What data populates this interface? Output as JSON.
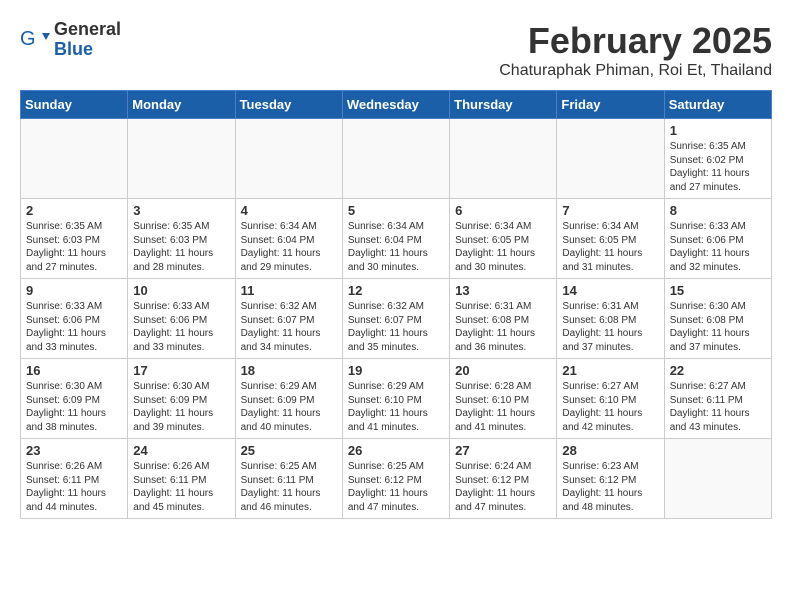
{
  "logo": {
    "general": "General",
    "blue": "Blue"
  },
  "title": "February 2025",
  "subtitle": "Chaturaphak Phiman, Roi Et, Thailand",
  "days_of_week": [
    "Sunday",
    "Monday",
    "Tuesday",
    "Wednesday",
    "Thursday",
    "Friday",
    "Saturday"
  ],
  "weeks": [
    [
      {
        "day": "",
        "info": ""
      },
      {
        "day": "",
        "info": ""
      },
      {
        "day": "",
        "info": ""
      },
      {
        "day": "",
        "info": ""
      },
      {
        "day": "",
        "info": ""
      },
      {
        "day": "",
        "info": ""
      },
      {
        "day": "1",
        "info": "Sunrise: 6:35 AM\nSunset: 6:02 PM\nDaylight: 11 hours and 27 minutes."
      }
    ],
    [
      {
        "day": "2",
        "info": "Sunrise: 6:35 AM\nSunset: 6:03 PM\nDaylight: 11 hours and 27 minutes."
      },
      {
        "day": "3",
        "info": "Sunrise: 6:35 AM\nSunset: 6:03 PM\nDaylight: 11 hours and 28 minutes."
      },
      {
        "day": "4",
        "info": "Sunrise: 6:34 AM\nSunset: 6:04 PM\nDaylight: 11 hours and 29 minutes."
      },
      {
        "day": "5",
        "info": "Sunrise: 6:34 AM\nSunset: 6:04 PM\nDaylight: 11 hours and 30 minutes."
      },
      {
        "day": "6",
        "info": "Sunrise: 6:34 AM\nSunset: 6:05 PM\nDaylight: 11 hours and 30 minutes."
      },
      {
        "day": "7",
        "info": "Sunrise: 6:34 AM\nSunset: 6:05 PM\nDaylight: 11 hours and 31 minutes."
      },
      {
        "day": "8",
        "info": "Sunrise: 6:33 AM\nSunset: 6:06 PM\nDaylight: 11 hours and 32 minutes."
      }
    ],
    [
      {
        "day": "9",
        "info": "Sunrise: 6:33 AM\nSunset: 6:06 PM\nDaylight: 11 hours and 33 minutes."
      },
      {
        "day": "10",
        "info": "Sunrise: 6:33 AM\nSunset: 6:06 PM\nDaylight: 11 hours and 33 minutes."
      },
      {
        "day": "11",
        "info": "Sunrise: 6:32 AM\nSunset: 6:07 PM\nDaylight: 11 hours and 34 minutes."
      },
      {
        "day": "12",
        "info": "Sunrise: 6:32 AM\nSunset: 6:07 PM\nDaylight: 11 hours and 35 minutes."
      },
      {
        "day": "13",
        "info": "Sunrise: 6:31 AM\nSunset: 6:08 PM\nDaylight: 11 hours and 36 minutes."
      },
      {
        "day": "14",
        "info": "Sunrise: 6:31 AM\nSunset: 6:08 PM\nDaylight: 11 hours and 37 minutes."
      },
      {
        "day": "15",
        "info": "Sunrise: 6:30 AM\nSunset: 6:08 PM\nDaylight: 11 hours and 37 minutes."
      }
    ],
    [
      {
        "day": "16",
        "info": "Sunrise: 6:30 AM\nSunset: 6:09 PM\nDaylight: 11 hours and 38 minutes."
      },
      {
        "day": "17",
        "info": "Sunrise: 6:30 AM\nSunset: 6:09 PM\nDaylight: 11 hours and 39 minutes."
      },
      {
        "day": "18",
        "info": "Sunrise: 6:29 AM\nSunset: 6:09 PM\nDaylight: 11 hours and 40 minutes."
      },
      {
        "day": "19",
        "info": "Sunrise: 6:29 AM\nSunset: 6:10 PM\nDaylight: 11 hours and 41 minutes."
      },
      {
        "day": "20",
        "info": "Sunrise: 6:28 AM\nSunset: 6:10 PM\nDaylight: 11 hours and 41 minutes."
      },
      {
        "day": "21",
        "info": "Sunrise: 6:27 AM\nSunset: 6:10 PM\nDaylight: 11 hours and 42 minutes."
      },
      {
        "day": "22",
        "info": "Sunrise: 6:27 AM\nSunset: 6:11 PM\nDaylight: 11 hours and 43 minutes."
      }
    ],
    [
      {
        "day": "23",
        "info": "Sunrise: 6:26 AM\nSunset: 6:11 PM\nDaylight: 11 hours and 44 minutes."
      },
      {
        "day": "24",
        "info": "Sunrise: 6:26 AM\nSunset: 6:11 PM\nDaylight: 11 hours and 45 minutes."
      },
      {
        "day": "25",
        "info": "Sunrise: 6:25 AM\nSunset: 6:11 PM\nDaylight: 11 hours and 46 minutes."
      },
      {
        "day": "26",
        "info": "Sunrise: 6:25 AM\nSunset: 6:12 PM\nDaylight: 11 hours and 47 minutes."
      },
      {
        "day": "27",
        "info": "Sunrise: 6:24 AM\nSunset: 6:12 PM\nDaylight: 11 hours and 47 minutes."
      },
      {
        "day": "28",
        "info": "Sunrise: 6:23 AM\nSunset: 6:12 PM\nDaylight: 11 hours and 48 minutes."
      },
      {
        "day": "",
        "info": ""
      }
    ]
  ]
}
